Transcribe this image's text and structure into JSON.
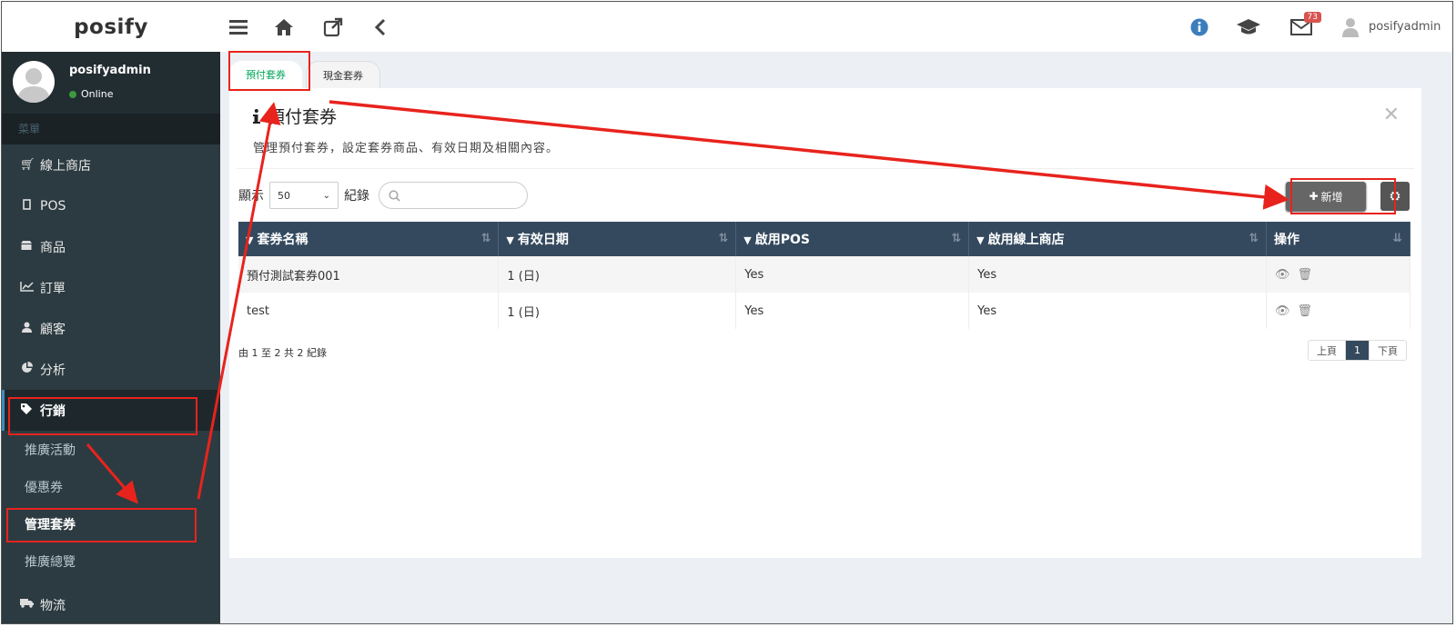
{
  "app": {
    "brand": "posify"
  },
  "topbar": {
    "icons": [
      "menu-icon",
      "home-icon",
      "external-link-icon",
      "chevron-left-icon"
    ],
    "right_icons": [
      "info-icon",
      "graduation-cap-icon",
      "envelope-icon"
    ],
    "mail_badge": "73",
    "username": "posifyadmin"
  },
  "sidebar": {
    "user": {
      "name": "posifyadmin",
      "status": "Online"
    },
    "header": "菜單",
    "items": [
      {
        "icon": "cart-icon",
        "label": "線上商店"
      },
      {
        "icon": "tablet-icon",
        "label": "POS"
      },
      {
        "icon": "store-icon",
        "label": "商品"
      },
      {
        "icon": "line-chart-icon",
        "label": "訂單"
      },
      {
        "icon": "user-icon",
        "label": "顧客"
      },
      {
        "icon": "pie-chart-icon",
        "label": "分析"
      },
      {
        "icon": "tags-icon",
        "label": "行銷"
      }
    ],
    "subitems": [
      {
        "label": "推廣活動"
      },
      {
        "label": "優惠券"
      },
      {
        "label": "管理套券"
      },
      {
        "label": "推廣總覽"
      }
    ],
    "bottom_item": {
      "icon": "truck-icon",
      "label": "物流"
    }
  },
  "tabs": [
    "預付套券",
    "現金套券"
  ],
  "panel": {
    "title": "預付套券",
    "subtitle": "管理預付套券，設定套券商品、有效日期及相關內容。",
    "show_label": "顯示",
    "page_size": "50",
    "records_label": "紀錄",
    "add_button": "新增"
  },
  "table": {
    "headers": [
      "套券名稱",
      "有效日期",
      "啟用POS",
      "啟用線上商店",
      "操作"
    ],
    "rows": [
      [
        "預付測試套券001",
        "1 (日)",
        "Yes",
        "Yes"
      ],
      [
        "test",
        "1 (日)",
        "Yes",
        "Yes"
      ]
    ],
    "info": "由 1 至 2 共 2 紀錄"
  },
  "pagination": {
    "prev": "上頁",
    "current": "1",
    "next": "下頁"
  },
  "colors": {
    "annotation": "#e8231d",
    "sidebar": "#2c3b41",
    "header": "#34495e",
    "active_tab": "#00a65a"
  }
}
